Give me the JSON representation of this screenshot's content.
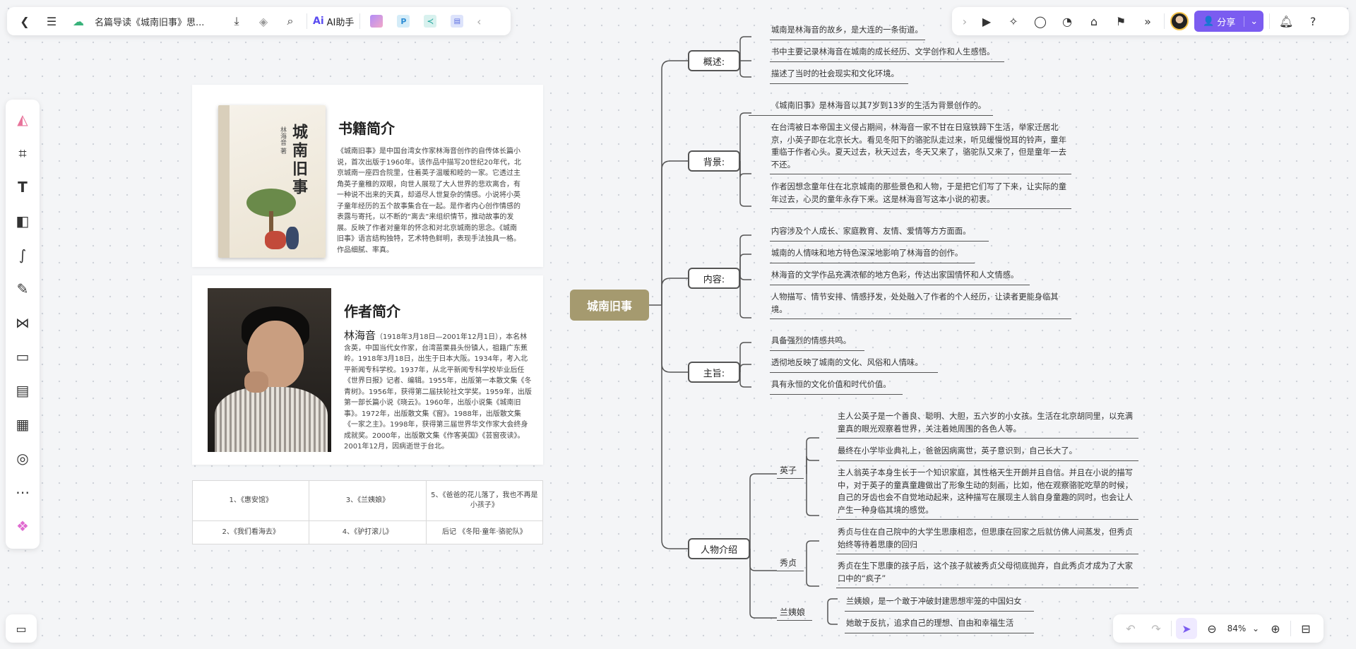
{
  "topbar": {
    "doc_title": "名篇导读《城南旧事》思...",
    "ai_label": "AI助手",
    "share_label": "分享"
  },
  "zoom": {
    "level": "84%"
  },
  "colors": {
    "accent": "#7b5cf0",
    "root": "#a59a6f"
  },
  "book": {
    "heading": "书籍简介",
    "cover_title": "城南旧事",
    "cover_author": "林海音 著",
    "text": "《城南旧事》是中国台湾女作家林海音创作的自传体长篇小说，首次出版于1960年。该作品中描写20世纪20年代，北京城南一座四合院里，住着英子温暖和睦的一家。它透过主角英子童稚的双眼，向世人展现了大人世界的悲欢离合，有一种说不出来的天真，却道尽人世复杂的情感。小说将小英子童年经历的五个故事集合在一起。是作者内心创作情感的表露与寄托，以不断的“离去”来组织情节，推动故事的发展。反映了作者对童年的怀念和对北京城南的思念。《城南旧事》语言结构独特，艺术特色鲜明，表现手法独具一格。作品细腻、率真。"
  },
  "author": {
    "heading": "作者简介",
    "name": "林海音",
    "bio_intro": "（1918年3月18日—2001年12月1日），本名林含英，中国当代女作家，台湾苗栗县头份镇人，祖籍广东蕉岭。1918年3月18日，出生于日本大阪。1934年，考入北平新闻专科学校。1937年，从北平新闻专科学校毕业后任《世界日报》记者、编辑。1955年，出版第一本散文集《冬青树》。1956年，获得第二届扶轮社文学奖。1959年，出版第一部长篇小说《晓云》。1960年，出版小说集《城南旧事》。1972年，出版散文集《窗》。1988年，出版散文集《一家之主》。1998年，获得第三届世界华文作家大会终身成就奖。2000年，出版散文集《作客美国》《芸窗夜读》。2001年12月，因病逝世于台北。"
  },
  "chapters": [
    [
      "1、《惠安馆》",
      "3、《兰姨娘》",
      "5、《爸爸的花儿落了，我也不再是小孩子》"
    ],
    [
      "2、《我们看海去》",
      "4、《驴打滚儿》",
      "后记 《冬阳·童年·骆驼队》"
    ]
  ],
  "mindmap": {
    "root": "城南旧事",
    "overview": {
      "label": "概述:",
      "items": [
        "城南是林海音的故乡，是大连的一条街道。",
        "书中主要记录林海音在城南的成长经历、文学创作和人生感悟。",
        "描述了当时的社会现实和文化环境。"
      ]
    },
    "background": {
      "label": "背景:",
      "items": [
        "《城南旧事》是林海音以其7岁到13岁的生活为背景创作的。",
        "在台湾被日本帝国主义侵占期间，林海音一家不甘在日寇铁蹄下生活，举家迁居北京，小英子即在北京长大。看见冬阳下的骆驼队走过来，听见缓慢悦耳的铃声，童年重临于作者心头。夏天过去，秋天过去，冬天又来了，骆驼队又来了，但是童年一去不还。",
        "作者因想念童年住在北京城南的那些景色和人物，于是把它们写了下来，让实际的童年过去，心灵的童年永存下来。这是林海音写这本小说的初衷。"
      ]
    },
    "content": {
      "label": "内容:",
      "items": [
        "内容涉及个人成长、家庭教育、友情、爱情等方方面面。",
        "城南的人情味和地方特色深深地影响了林海音的创作。",
        "林海音的文学作品充满浓郁的地方色彩，传达出家国情怀和人文情感。",
        "人物描写、情节安排、情感抒发，处处融入了作者的个人经历，让读者更能身临其境。"
      ]
    },
    "theme": {
      "label": "主旨:",
      "items": [
        "具备强烈的情感共鸣。",
        "透彻地反映了城南的文化、风俗和人情味。",
        "具有永恒的文化价值和时代价值。"
      ]
    },
    "characters": {
      "label": "人物介绍",
      "yingzi": {
        "name": "英子",
        "items": [
          "主人公英子是一个善良、聪明、大胆，五六岁的小女孩。生活在北京胡同里，以充满童真的眼光观察着世界，关注着她周围的各色人等。",
          "最终在小学毕业典礼上，爸爸因病离世，英子意识到，自己长大了。",
          "主人翁英子本身生长于一个知识家庭，其性格天生开朗并且自信。并且在小说的描写中，对于英子的童真童趣做出了形象生动的刻画，比如，他在观察骆驼吃草的时候，自己的牙齿也会不自觉地动起来，这种描写在展现主人翁自身童趣的同时，也会让人产生一种身临其境的感觉。"
        ]
      },
      "xiuzhen": {
        "name": "秀贞",
        "items": [
          "秀贞与住在自己院中的大学生思康相恋，但思康在回家之后就仿佛人间蒸发，但秀贞始终等待着思康的回归",
          "秀贞在生下思康的孩子后，这个孩子就被秀贞父母彻底抛弃，自此秀贞才成为了大家口中的“疯子”"
        ]
      },
      "lanyiniang": {
        "name": "兰姨娘",
        "items": [
          "兰姨娘，是一个敢于冲破封建思想牢笼的中国妇女",
          "她敢于反抗，追求自己的理想、自由和幸福生活"
        ]
      }
    }
  }
}
